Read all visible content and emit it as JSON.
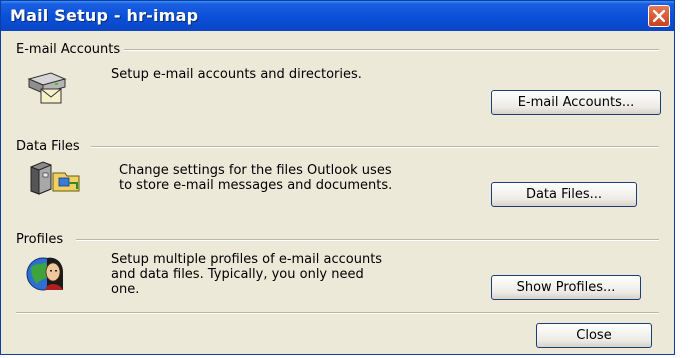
{
  "window": {
    "title": "Mail Setup - hr-imap"
  },
  "sections": {
    "email_accounts": {
      "label": "E-mail Accounts",
      "description": "Setup e-mail accounts and directories.",
      "button_label": "E-mail Accounts...",
      "icon": "mail-server-icon"
    },
    "data_files": {
      "label": "Data Files",
      "description_line1": "Change settings for the files Outlook uses",
      "description_line2": "to store e-mail messages and documents.",
      "button_label": "Data Files...",
      "icon": "data-files-icon"
    },
    "profiles": {
      "label": "Profiles",
      "description_line1": "Setup multiple profiles of e-mail accounts",
      "description_line2": "and data files. Typically, you only need",
      "description_line3": "one.",
      "button_label": "Show Profiles...",
      "icon": "profiles-icon"
    }
  },
  "footer": {
    "close_label": "Close"
  },
  "colors": {
    "titlebar": "#0a4fd8",
    "dialog_bg": "#ece9d8",
    "close_button": "#d9532c"
  }
}
